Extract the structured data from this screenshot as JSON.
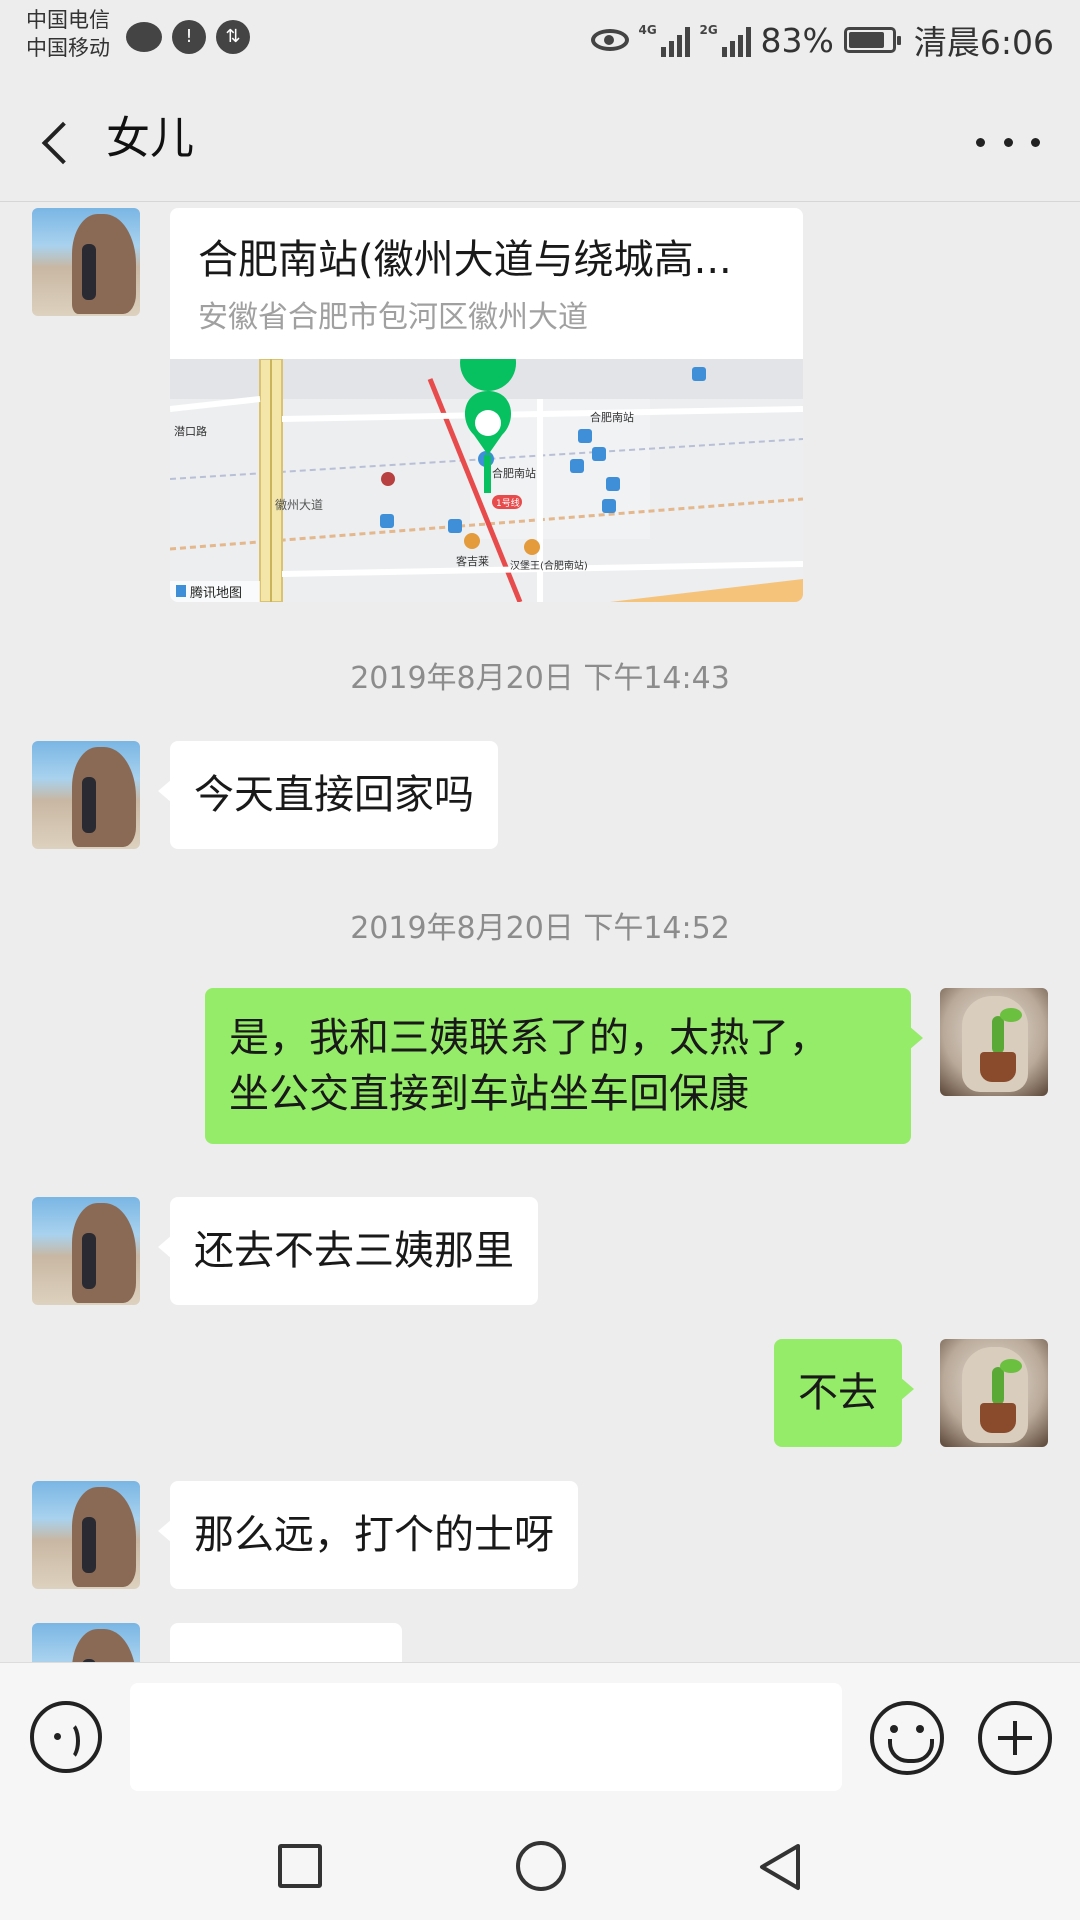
{
  "status_bar": {
    "carrier_1": "中国电信",
    "carrier_2": "中国移动",
    "network_1": "4G",
    "network_2": "2G",
    "battery": "83%",
    "battery_level": 0.83,
    "time": "清晨6:06",
    "icons": [
      "chat-bubble-icon",
      "cloud-alert-icon",
      "data-transfer-icon",
      "eye-icon",
      "signal-icon",
      "signal-icon",
      "battery-icon"
    ]
  },
  "header": {
    "back_icon": "chevron-left-icon",
    "title": "女儿",
    "more_icon": "more-dots-icon"
  },
  "messages": [
    {
      "type": "location",
      "direction": "in",
      "title": "合肥南站(徽州大道与绕城高...",
      "address": "安徽省合肥市包河区徽州大道",
      "map": {
        "provider": "腾讯地图",
        "labels": [
          "潜口路",
          "徽州大道",
          "合肥南站",
          "合肥南站",
          "客吉莱",
          "汉堡王(合肥南站)",
          "1号线"
        ]
      }
    },
    {
      "type": "time",
      "text": "2019年8月20日 下午14:43"
    },
    {
      "type": "text",
      "direction": "in",
      "text": "今天直接回家吗"
    },
    {
      "type": "time",
      "text": "2019年8月20日 下午14:52"
    },
    {
      "type": "text",
      "direction": "out",
      "lines": [
        "是，我和三姨联系了的，太热了，",
        "坐公交直接到车站坐车回保康"
      ]
    },
    {
      "type": "text",
      "direction": "in",
      "text": "还去不去三姨那里"
    },
    {
      "type": "text",
      "direction": "out",
      "text": "不去"
    },
    {
      "type": "text",
      "direction": "in",
      "text": "那么远，打个的士呀"
    }
  ],
  "input_bar": {
    "voice_icon": "voice-input-icon",
    "text_value": "",
    "emoji_icon": "emoji-icon",
    "plus_icon": "plus-icon"
  },
  "nav_bar": {
    "icons": [
      "recent-apps-icon",
      "home-icon",
      "back-triangle-icon"
    ]
  },
  "colors": {
    "background": "#ededed",
    "bubble_in": "#ffffff",
    "bubble_out": "#95ec69",
    "timestamp": "#8c8c8c",
    "map_pin": "#07c160"
  }
}
